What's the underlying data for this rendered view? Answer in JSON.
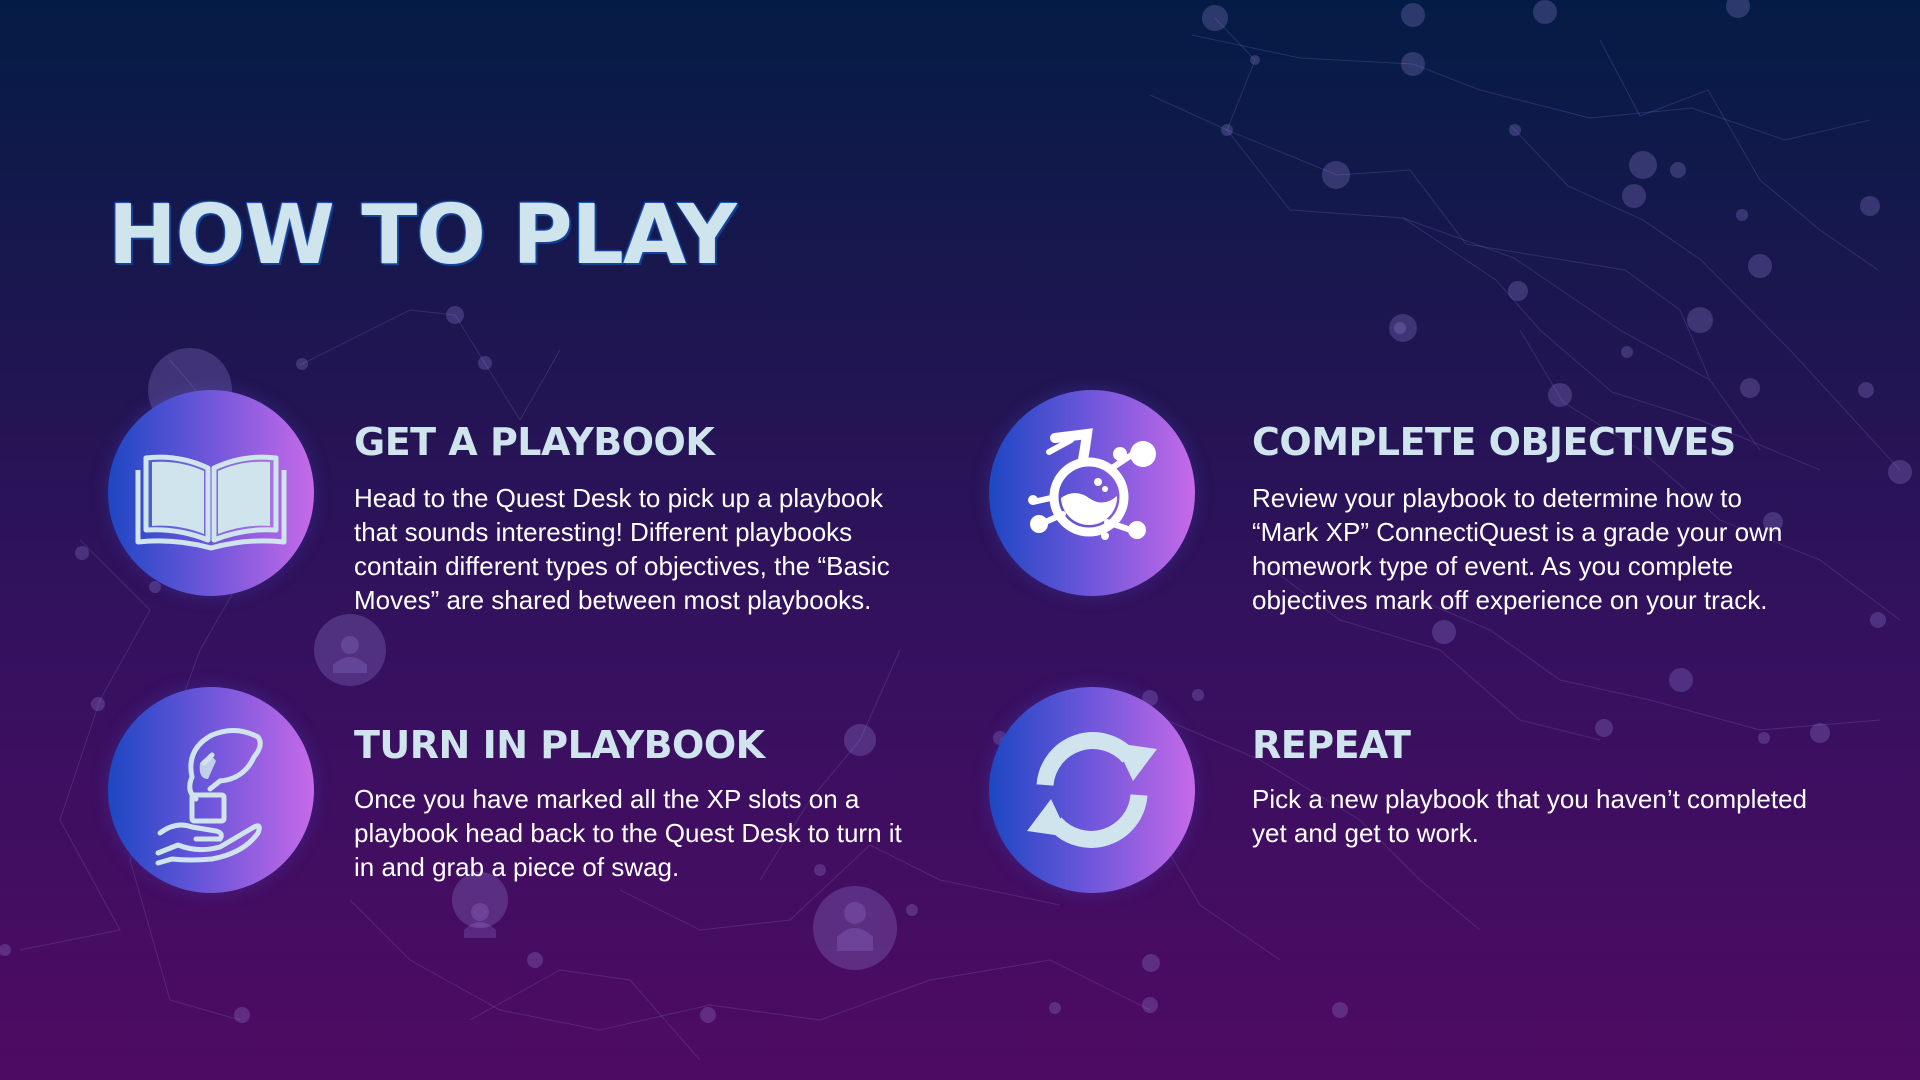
{
  "title": "HOW TO PLAY",
  "accent_colors": {
    "heading": "#cfe4ec",
    "icon_gradient_start": "#1d47c3",
    "icon_gradient_end": "#c66ae8",
    "background_top": "#041c45",
    "background_bottom": "#4e0b63"
  },
  "steps": [
    {
      "icon": "open-book-icon",
      "heading": "GET A PLAYBOOK",
      "text": "Head to the Quest Desk to pick up a playbook that sounds interesting! Different playbooks contain different types of objectives, the “Basic Moves” are shared between most playbooks."
    },
    {
      "icon": "flask-icon",
      "heading": "COMPLETE OBJECTIVES",
      "text": "Review your playbook to determine how to “Mark XP” ConnectiQuest is a grade your own homework type of event. As you complete objectives mark off experience on your track."
    },
    {
      "icon": "hand-drop-icon",
      "heading": "TURN IN PLAYBOOK",
      "text": "Once you have marked all the XP slots on a playbook head back to the Quest Desk to turn it in and grab a piece of swag."
    },
    {
      "icon": "refresh-icon",
      "heading": "REPEAT",
      "text": "Pick a new playbook that you haven’t completed yet and get to work."
    }
  ]
}
